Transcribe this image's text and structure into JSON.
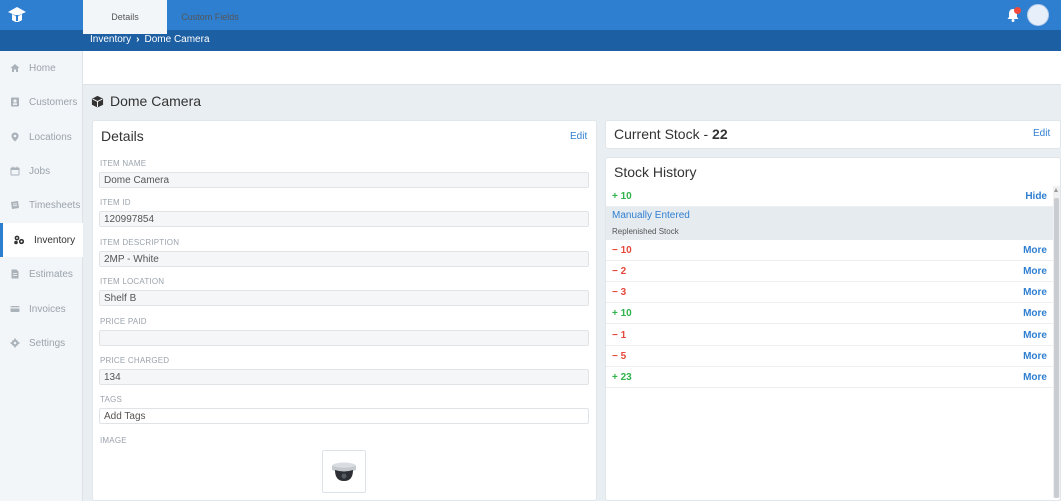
{
  "breadcrumb": {
    "parent": "Inventory",
    "separator": "›",
    "current": "Dome Camera"
  },
  "sidebar": {
    "items": [
      {
        "label": "Home",
        "icon": "home-icon"
      },
      {
        "label": "Customers",
        "icon": "customers-icon"
      },
      {
        "label": "Locations",
        "icon": "location-pin-icon"
      },
      {
        "label": "Jobs",
        "icon": "calendar-icon"
      },
      {
        "label": "Timesheets",
        "icon": "timesheet-icon"
      },
      {
        "label": "Inventory",
        "icon": "inventory-icon",
        "active": true
      },
      {
        "label": "Estimates",
        "icon": "estimate-icon"
      },
      {
        "label": "Invoices",
        "icon": "invoice-icon"
      },
      {
        "label": "Settings",
        "icon": "gear-icon"
      }
    ]
  },
  "tabs": [
    {
      "label": "Details",
      "active": true
    },
    {
      "label": "Custom Fields"
    }
  ],
  "page_title": "Dome Camera",
  "details": {
    "title": "Details",
    "edit_label": "Edit",
    "fields": [
      {
        "label": "ITEM NAME",
        "value": "Dome Camera"
      },
      {
        "label": "ITEM ID",
        "value": "120997854"
      },
      {
        "label": "ITEM DESCRIPTION",
        "value": "2MP - White"
      },
      {
        "label": "ITEM LOCATION",
        "value": "Shelf B"
      },
      {
        "label": "PRICE PAID",
        "value": ""
      },
      {
        "label": "PRICE CHARGED",
        "value": "134"
      },
      {
        "label": "TAGS",
        "value": "Add Tags"
      }
    ],
    "image_label": "IMAGE"
  },
  "current_stock": {
    "title": "Current Stock - ",
    "value": "22",
    "edit_label": "Edit"
  },
  "stock_history": {
    "title": "Stock History",
    "expanded": {
      "qty": "10",
      "sign": "+",
      "action": "Hide",
      "source": "Manually Entered",
      "note": "Replenished Stock"
    },
    "rows": [
      {
        "sign": "−",
        "qty": "10",
        "action": "More"
      },
      {
        "sign": "−",
        "qty": "2",
        "action": "More"
      },
      {
        "sign": "−",
        "qty": "3",
        "action": "More"
      },
      {
        "sign": "+",
        "qty": "10",
        "action": "More"
      },
      {
        "sign": "−",
        "qty": "1",
        "action": "More"
      },
      {
        "sign": "−",
        "qty": "5",
        "action": "More"
      },
      {
        "sign": "+",
        "qty": "23",
        "action": "More"
      }
    ]
  },
  "colors": {
    "primary": "#2f7fd1",
    "dark_bar": "#1d5fa3",
    "positive": "#2fb34a",
    "negative": "#e5483a"
  }
}
